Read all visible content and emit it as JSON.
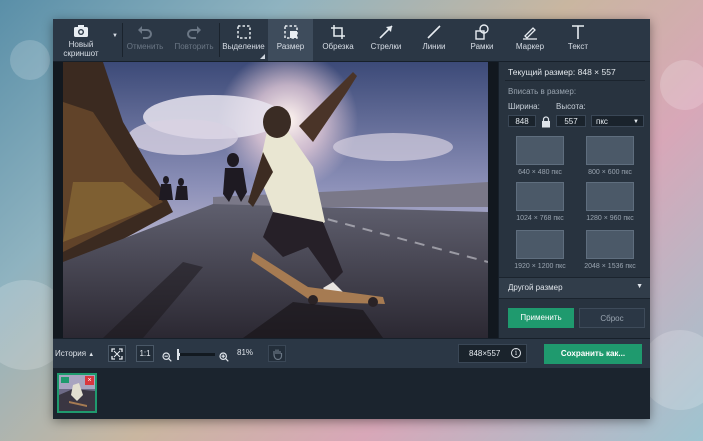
{
  "toolbar": {
    "new_screenshot": "Новый\nскриншот",
    "undo": "Отменить",
    "redo": "Повторить",
    "select": "Выделение",
    "resize": "Размер",
    "crop": "Обрезка",
    "arrows": "Стрелки",
    "lines": "Линии",
    "frames": "Рамки",
    "marker": "Маркер",
    "text": "Текст"
  },
  "panel": {
    "current_size": "Текущий размер: 848 × 557",
    "fit_label": "Вписать в размер:",
    "width_label": "Ширина:",
    "height_label": "Высота:",
    "width_value": "848",
    "height_value": "557",
    "unit": "пкс",
    "presets": [
      {
        "label": "640 × 480 пкс"
      },
      {
        "label": "800 × 600 пкс"
      },
      {
        "label": "1024 × 768 пкс"
      },
      {
        "label": "1280 × 960 пкс"
      },
      {
        "label": "1920 × 1200 пкс"
      },
      {
        "label": "2048 × 1536 пкс"
      }
    ],
    "other_size": "Другой размер",
    "apply": "Применить",
    "reset": "Сброс"
  },
  "bottombar": {
    "history": "История",
    "ratio": "1:1",
    "zoom": "81%",
    "zoom_level": 0.81,
    "dimensions": "848×557",
    "save": "Сохранить как..."
  },
  "colors": {
    "accent_green": "#1f9a6e",
    "toolbar_bg": "#2b3745",
    "close_red": "#d9363e"
  }
}
